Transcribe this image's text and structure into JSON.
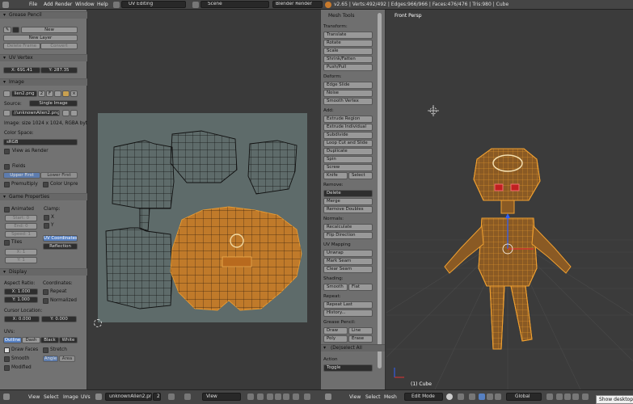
{
  "topbar": {
    "menus": [
      "File",
      "Add",
      "Render",
      "Window",
      "Help"
    ],
    "layout": "UV Editing",
    "scene": "Scene",
    "engine": "Blender Render",
    "stats": "v2.65 | Verts:492/492 | Edges:966/966 | Faces:476/476 | Tris:980 | Cube"
  },
  "left": {
    "grease": {
      "title": "Grease Pencil",
      "new": "New",
      "new_layer": "New Layer",
      "delete_frame": "Delete Frame",
      "convert": "Convert"
    },
    "uv_vertex": {
      "title": "UV Vertex",
      "x": "X: 691.41",
      "y": "Y: 287.35"
    },
    "image": {
      "title": "Image",
      "name": "lien2.png",
      "users": "2",
      "fake": "F",
      "source_label": "Source:",
      "source": "Single Image",
      "path": "//unknownAlien2.png",
      "info": "Image: size 1024 x 1024, RGBA byt",
      "color_space_label": "Color Space:",
      "color_space": "sRGB",
      "view_as_render": "View as Render",
      "fields": "Fields",
      "upper_first": "Upper First",
      "lower_first": "Lower First",
      "premultiply": "Premultiply",
      "color_unpre": "Color Unpre"
    },
    "game": {
      "title": "Game Properties",
      "animated": "Animated",
      "clamp": "Clamp:",
      "start": "Start: 0",
      "end": "End: 0",
      "speed": "Speed: 1",
      "x": "X",
      "y": "Y",
      "tiles": "Tiles",
      "uv_coordinates": "UV Coordinates",
      "reflection": "Reflection",
      "tx": "X: 1",
      "ty": "Y: 1"
    },
    "display": {
      "title": "Display",
      "aspect": "Aspect Ratio:",
      "coords": "Coordinates:",
      "ax": "X: 1.000",
      "ay": "Y: 1.000",
      "repeat": "Repeat",
      "normalized": "Normalized",
      "cursor": "Cursor Location:",
      "cx": "X: 0.000",
      "cy": "Y: 0.000",
      "uvs": "UVs:",
      "outline": "Outline",
      "dash": "Dash",
      "black": "Black",
      "white": "White",
      "draw_faces": "Draw Faces",
      "stretch": "Stretch",
      "smooth": "Smooth",
      "angle": "Angle",
      "area": "Area",
      "modified": "Modified"
    }
  },
  "tools": {
    "title": "Mesh Tools",
    "transform": "Transform:",
    "translate": "Translate",
    "rotate": "Rotate",
    "scale": "Scale",
    "shrink": "Shrink/Fatten",
    "pushpull": "Push/Pull",
    "deform": "Deform:",
    "edge_slide": "Edge Slide",
    "noise": "Noise",
    "smooth_vertex": "Smooth Vertex",
    "add": "Add:",
    "extrude_region": "Extrude Region",
    "extrude_individual": "Extrude Individual",
    "subdivide": "Subdivide",
    "loop_cut": "Loop Cut and Slide",
    "duplicate": "Duplicate",
    "spin": "Spin",
    "screw": "Screw",
    "knife": "Knife",
    "select": "Select",
    "remove": "Remove:",
    "delete": "Delete",
    "merge": "Merge",
    "remove_doubles": "Remove Doubles",
    "normals": "Normals:",
    "recalculate": "Recalculate",
    "flip": "Flip Direction",
    "uv_mapping": "UV Mapping",
    "unwrap": "Unwrap",
    "mark_seam": "Mark Seam",
    "clear_seam": "Clear Seam",
    "shading": "Shading:",
    "smooth": "Smooth",
    "flat": "Flat",
    "repeat": "Repeat:",
    "repeat_last": "Repeat Last",
    "history": "History...",
    "grease": "Grease Pencil:",
    "draw": "Draw",
    "line": "Line",
    "poly": "Poly",
    "erase": "Erase",
    "deselect": "(De)select All",
    "action": "Action",
    "toggle": "Toggle"
  },
  "viewport": {
    "label": "Front Persp",
    "object": "(1) Cube"
  },
  "bottom": {
    "view": "View",
    "select": "Select",
    "image": "Image",
    "uvs": "UVs",
    "image_name": "unknownAlien2.png",
    "image_users": "2",
    "view2": "View",
    "view3d": "View",
    "select3d": "Select",
    "mesh": "Mesh",
    "mode": "Edit Mode",
    "orient": "Global",
    "tooltip": "Show desktop"
  },
  "colors": {
    "accent": "#5680c2",
    "mesh_orange": "#d9891f",
    "selected": "#e89a30"
  }
}
